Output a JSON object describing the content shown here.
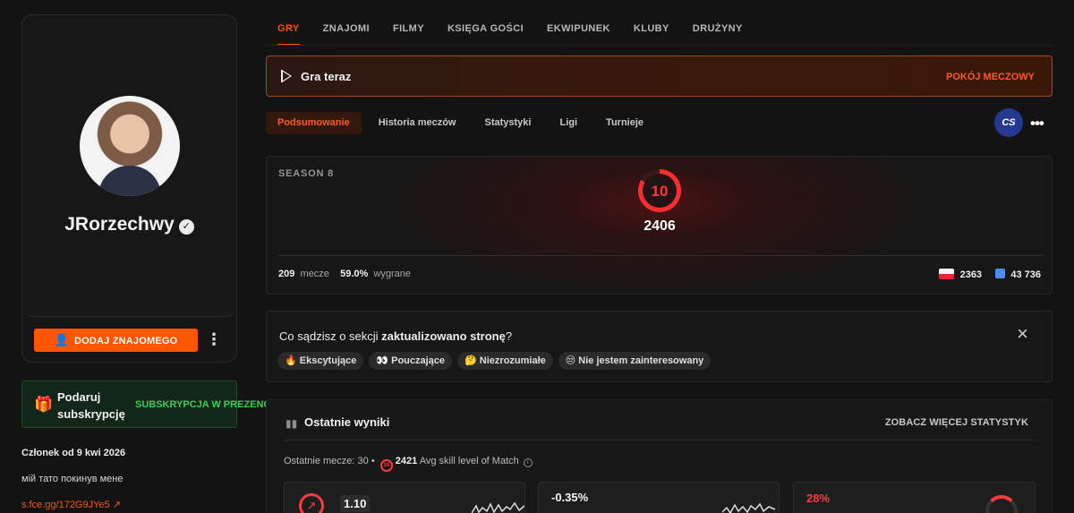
{
  "profile": {
    "username": "JRorzechwy",
    "add_friend_label": "DODAJ ZNAJOMEGO",
    "gift_title": "Podaruj subskrypcję",
    "gift_subtitle": "SUBSKRYPCJA W PREZENCIE",
    "member_since": "Członek od 9 kwi 2026",
    "bio": "мій тато покинув мене",
    "link": "s.fce.gg/172G9JYe5"
  },
  "tabs": [
    {
      "label": "GRY",
      "active": true
    },
    {
      "label": "ZNAJOMI",
      "active": false
    },
    {
      "label": "FILMY",
      "active": false
    },
    {
      "label": "KSIĘGA GOŚCI",
      "active": false
    },
    {
      "label": "EKWIPUNEK",
      "active": false
    },
    {
      "label": "KLUBY",
      "active": false
    },
    {
      "label": "DRUŻYNY",
      "active": false
    }
  ],
  "play_banner": {
    "label": "Gra teraz",
    "room_link": "POKÓJ MECZOWY"
  },
  "sub_tabs": [
    {
      "label": "Podsumowanie",
      "active": true
    },
    {
      "label": "Historia meczów",
      "active": false
    },
    {
      "label": "Statystyki",
      "active": false
    },
    {
      "label": "Ligi",
      "active": false
    },
    {
      "label": "Turnieje",
      "active": false
    }
  ],
  "game_badge": "CS",
  "season": {
    "label": "SEASON 8",
    "level": "10",
    "elo": "2406",
    "matches_count": "209",
    "matches_label": "mecze",
    "win_rate": "59.0%",
    "win_label": "wygrane",
    "country_rank": "2363",
    "world_rank": "43 736"
  },
  "survey": {
    "question_prefix": "Co sądzisz o sekcji ",
    "question_bold": "zaktualizowano stronę",
    "question_suffix": "?",
    "reactions": [
      "🔥 Ekscytujące",
      "👀 Pouczające",
      "🤔 Niezrozumiałe",
      "😒 Nie jestem zainteresowany"
    ]
  },
  "results": {
    "title": "Ostatnie wyniki",
    "more_stats_label": "ZOBACZ WIĘCEJ STATYSTYK",
    "recent_label": "Ostatnie mecze: 30 •",
    "mini_level": "10",
    "avg_elo": "2421",
    "avg_label": "Avg skill level of Match",
    "cards": [
      {
        "value": "1.10"
      },
      {
        "value": "-0.35%"
      },
      {
        "value": "28%"
      }
    ]
  },
  "colors": {
    "accent": "#ff5500",
    "level": "#ff2d2d",
    "gift_green": "#35d053"
  }
}
